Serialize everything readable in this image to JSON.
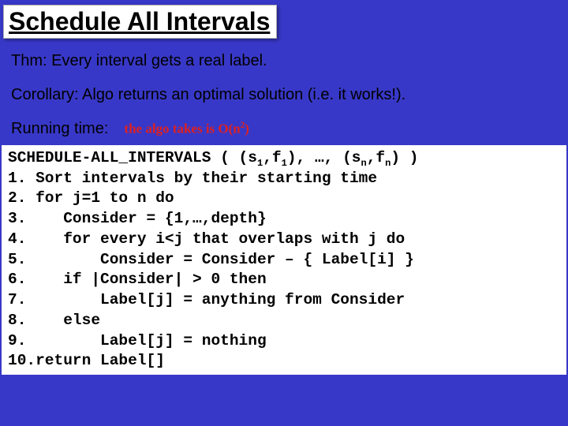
{
  "title": "Schedule All Intervals",
  "thm": "Thm: Every interval gets a real label.",
  "corollary": "Corollary: Algo returns an optimal solution (i.e. it works!).",
  "running_time_label": "Running time:",
  "annotation_prefix": "the algo takes is O(n",
  "annotation_exp": "2",
  "annotation_suffix": ")",
  "code": {
    "sig_prefix": "SCHEDULE-ALL_INTERVALS ( (s",
    "sub1": "1",
    "sig_mid1": ",f",
    "sig_mid2": "), …, (s",
    "subn": "n",
    "sig_mid3": ",f",
    "sig_suffix": ") )",
    "l1": "1. Sort intervals by their starting time",
    "l2": "2. for j=1 to n do",
    "l3": "3.    Consider = {1,…,depth}",
    "l4": "4.    for every i<j that overlaps with j do",
    "l5": "5.        Consider = Consider – { Label[i] }",
    "l6": "6.    if |Consider| > 0 then",
    "l7": "7.        Label[j] = anything from Consider",
    "l8": "8.    else",
    "l9": "9.        Label[j] = nothing",
    "l10": "10.return Label[]"
  }
}
